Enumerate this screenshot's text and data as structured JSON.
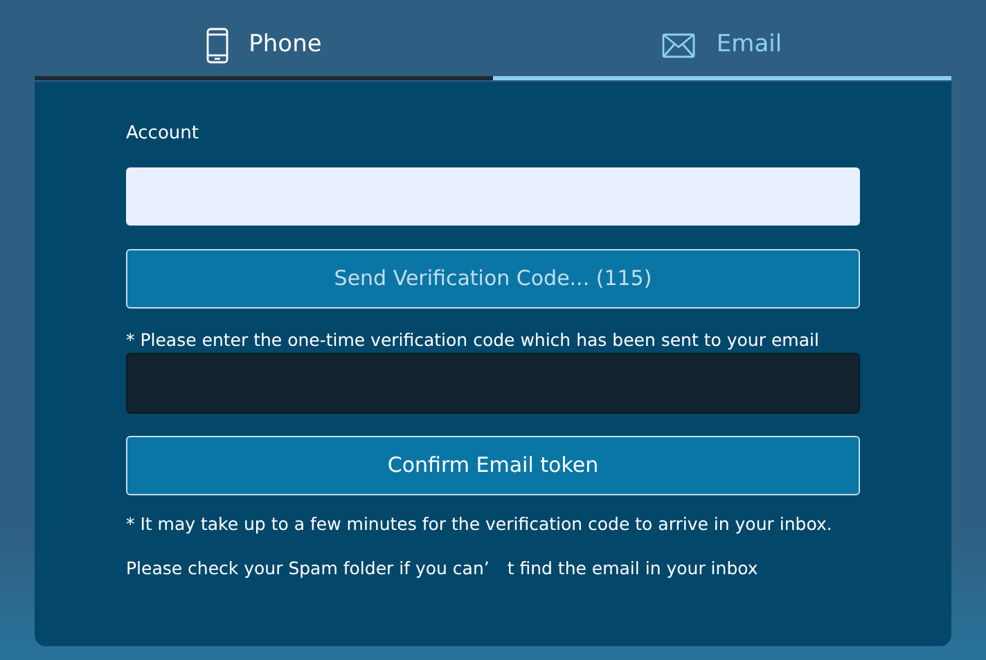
{
  "tabs": [
    {
      "label": "Phone",
      "kind": "phone",
      "selected": false
    },
    {
      "label": "Email",
      "kind": "email",
      "selected": true
    }
  ],
  "account": {
    "label": "Account"
  },
  "send_button": {
    "label": "Send Verification Code... (115)",
    "disabled": true
  },
  "code": {
    "label": "* Please enter the one-time verification code which has been sent to your email"
  },
  "confirm_button": {
    "label": "Confirm Email token",
    "disabled": false
  },
  "notes": [
    "* It may take up to a few minutes for the verification code to arrive in your inbox.",
    "Please check your Spam folder if you can’　t find the email in your inbox"
  ]
}
